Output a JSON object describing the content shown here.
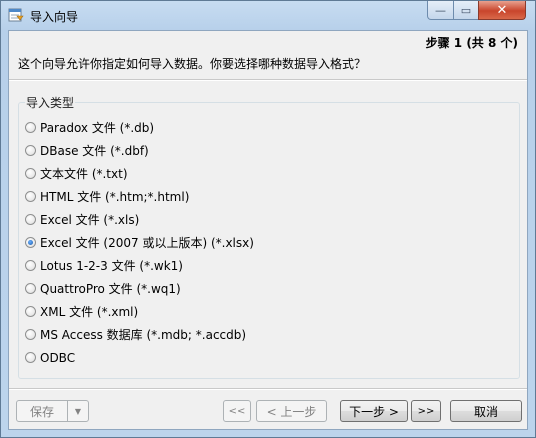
{
  "window": {
    "title": "导入向导",
    "minimize_glyph": "—",
    "maximize_glyph": "▭",
    "close_glyph": "✕"
  },
  "header": {
    "step_text": "步骤 1 (共 8 个)",
    "question": "这个向导允许你指定如何导入数据。你要选择哪种数据导入格式？"
  },
  "import_type": {
    "group_label": "导入类型",
    "selected_index": 5,
    "options": [
      "Paradox 文件 (*.db)",
      "DBase 文件 (*.dbf)",
      "文本文件 (*.txt)",
      "HTML 文件 (*.htm;*.html)",
      "Excel 文件 (*.xls)",
      "Excel 文件 (2007 或以上版本) (*.xlsx)",
      "Lotus 1-2-3 文件 (*.wk1)",
      "QuattroPro 文件 (*.wq1)",
      "XML 文件 (*.xml)",
      "MS Access 数据库 (*.mdb; *.accdb)",
      "ODBC"
    ]
  },
  "footer": {
    "save_label": "保存",
    "save_dropdown_glyph": "▼",
    "first_label": "<<",
    "prev_label": "< 上一步",
    "next_label": "下一步 >",
    "last_label": ">>",
    "cancel_label": "取消"
  }
}
